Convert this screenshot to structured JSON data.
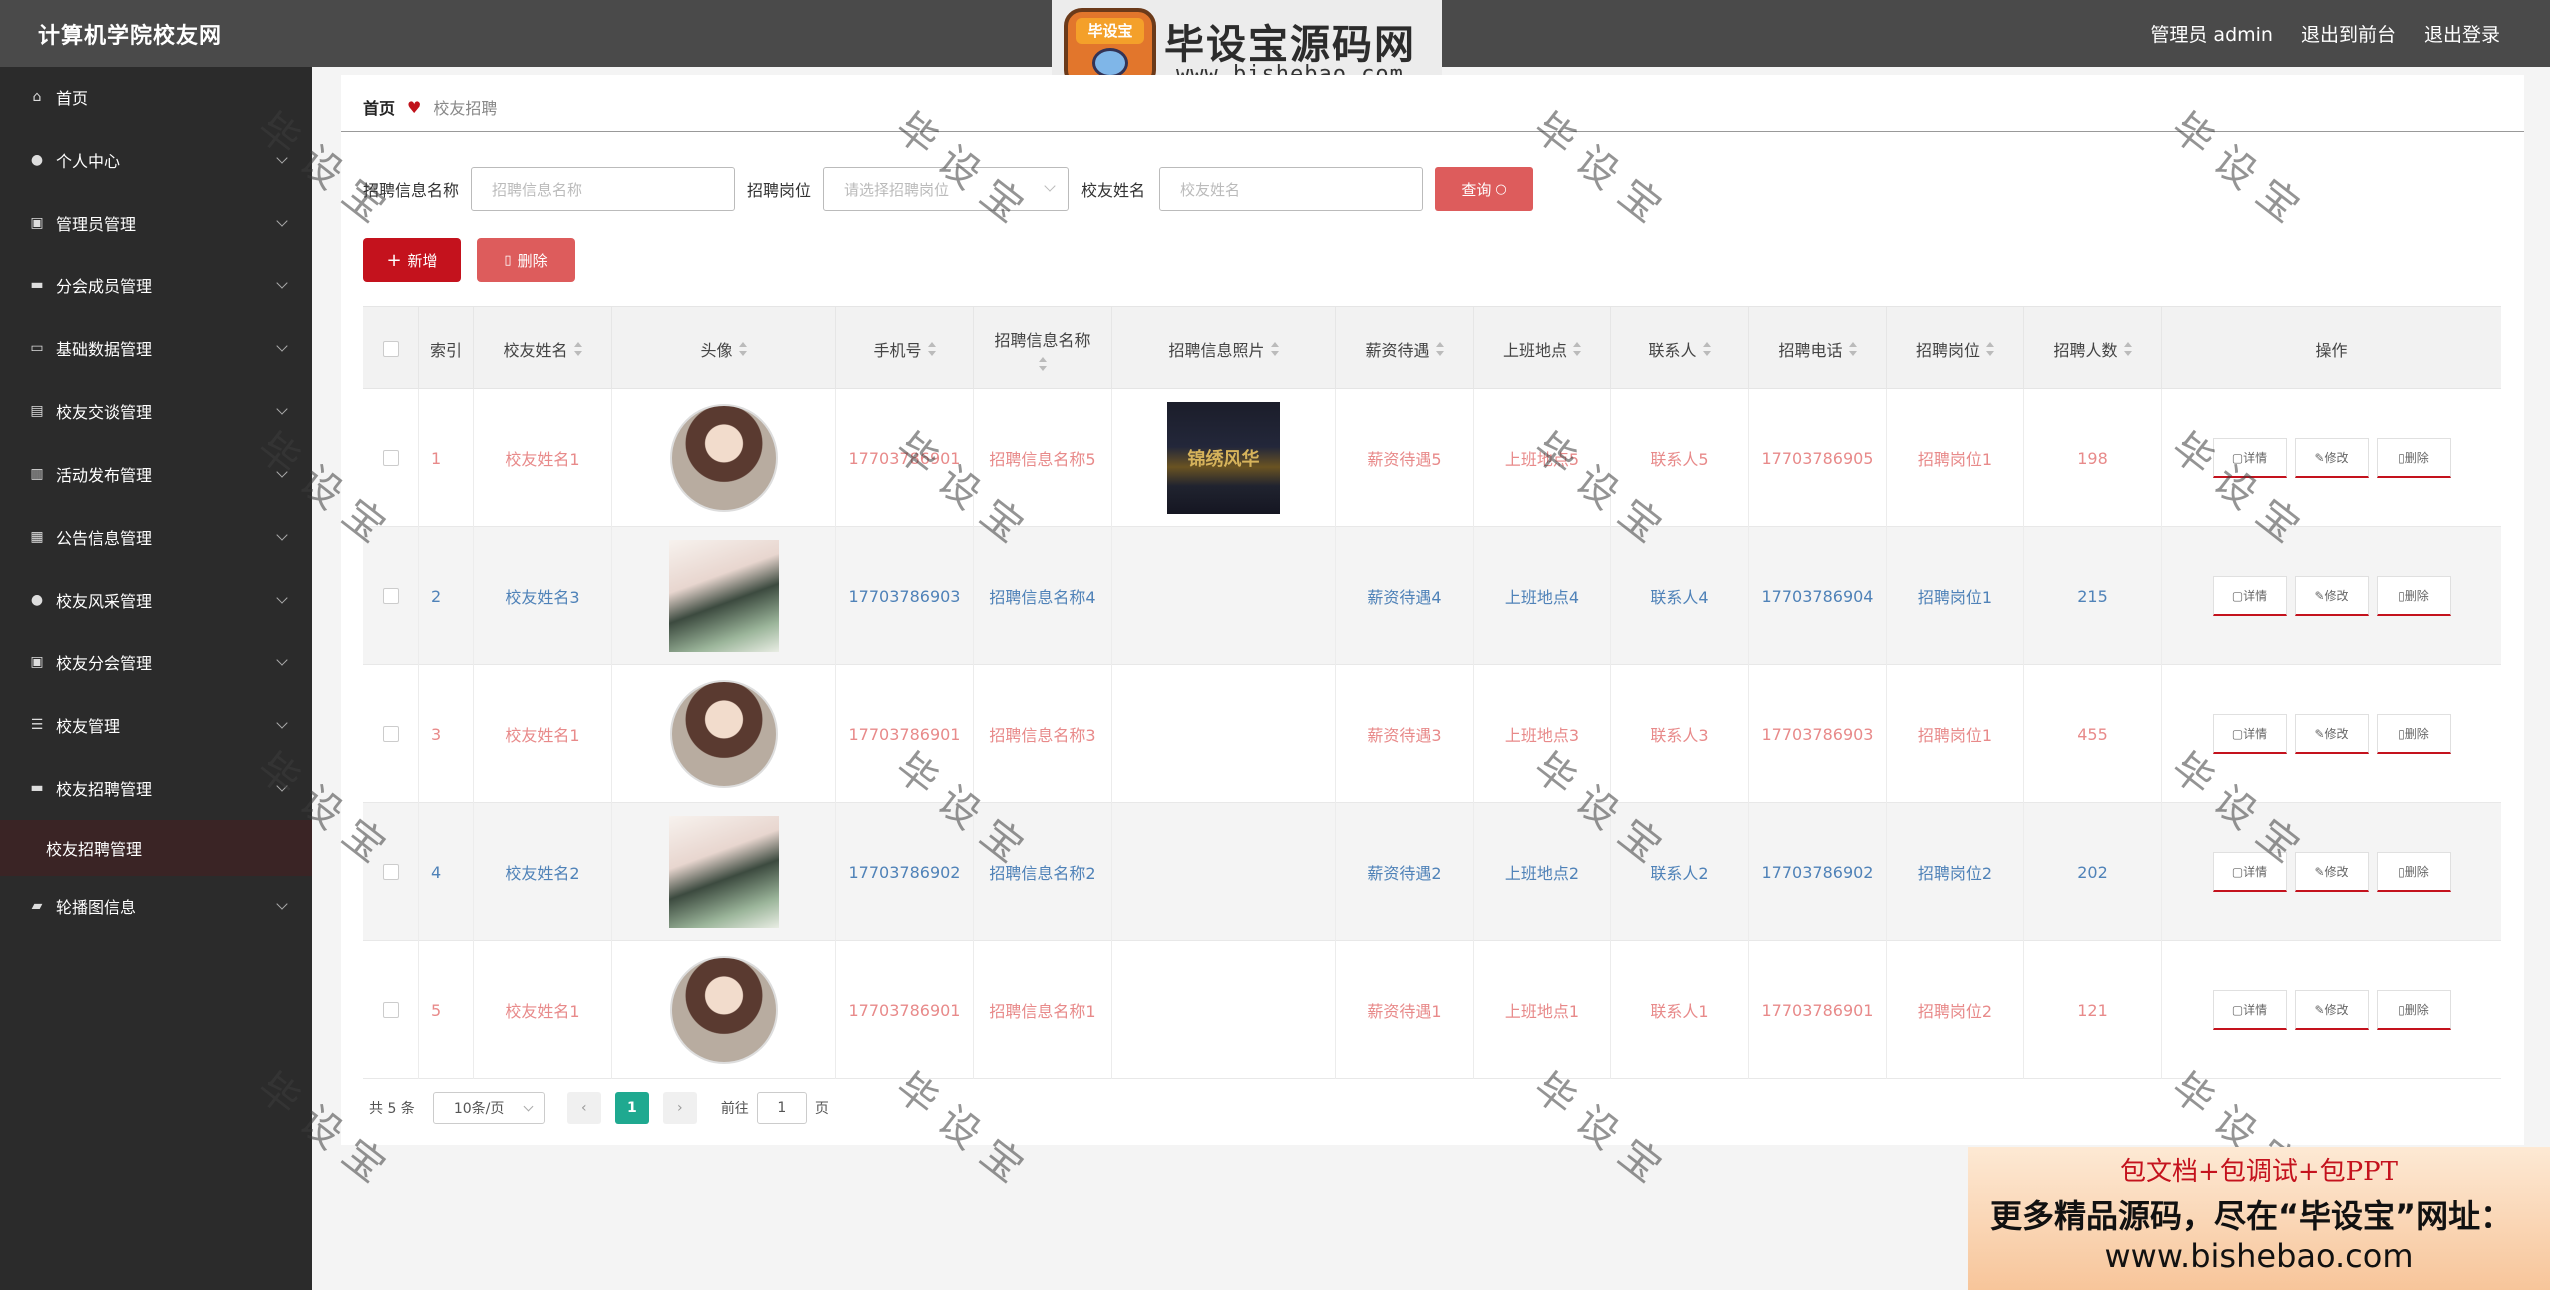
{
  "topbar": {
    "brand": "计算机学院校友网",
    "admin": "管理员 admin",
    "to_front": "退出到前台",
    "logout": "退出登录"
  },
  "logo": {
    "badge": "毕设宝",
    "title": "毕设宝源码网",
    "url": "www.bishebao.com"
  },
  "sidebar": {
    "items": [
      {
        "label": "首页",
        "icon": "home-icon"
      },
      {
        "label": "个人中心",
        "icon": "user-icon"
      },
      {
        "label": "管理员管理",
        "icon": "clipboard-icon"
      },
      {
        "label": "分会成员管理",
        "icon": "chat-icon"
      },
      {
        "label": "基础数据管理",
        "icon": "data-icon"
      },
      {
        "label": "校友交谈管理",
        "icon": "briefcase-icon"
      },
      {
        "label": "活动发布管理",
        "icon": "chart-icon"
      },
      {
        "label": "公告信息管理",
        "icon": "grid-icon"
      },
      {
        "label": "校友风采管理",
        "icon": "mic-icon"
      },
      {
        "label": "校友分会管理",
        "icon": "clipboard-icon"
      },
      {
        "label": "校友管理",
        "icon": "list-icon"
      },
      {
        "label": "校友招聘管理",
        "icon": "laptop-icon"
      },
      {
        "label": "轮播图信息",
        "icon": "image-icon"
      }
    ],
    "sub_active": "校友招聘管理"
  },
  "breadcrumb": {
    "home": "首页",
    "current": "校友招聘"
  },
  "search": {
    "label1": "招聘信息名称",
    "placeholder1": "招聘信息名称",
    "label2": "招聘岗位",
    "placeholder2": "请选择招聘岗位",
    "label3": "校友姓名",
    "placeholder3": "校友姓名",
    "query_label": "查询"
  },
  "actions": {
    "add_label": "新增",
    "delete_label": "删除"
  },
  "table": {
    "headers": {
      "index": "索引",
      "name": "校友姓名",
      "avatar": "头像",
      "phone": "手机号",
      "title": "招聘信息名称",
      "photo": "招聘信息照片",
      "salary": "薪资待遇",
      "place": "上班地点",
      "contact": "联系人",
      "tel": "招聘电话",
      "post": "招聘岗位",
      "count": "招聘人数",
      "ops": "操作"
    },
    "rows": [
      {
        "index": "1",
        "name": "校友姓名1",
        "phone": "17703786901",
        "title": "招聘信息名称5",
        "photo": "poster",
        "salary": "薪资待遇5",
        "place": "上班地点5",
        "contact": "联系人5",
        "tel": "17703786905",
        "post": "招聘岗位1",
        "count": "198",
        "avatar": "round"
      },
      {
        "index": "2",
        "name": "校友姓名3",
        "phone": "17703786903",
        "title": "招聘信息名称4",
        "photo": "",
        "salary": "薪资待遇4",
        "place": "上班地点4",
        "contact": "联系人4",
        "tel": "17703786904",
        "post": "招聘岗位1",
        "count": "215",
        "avatar": "square"
      },
      {
        "index": "3",
        "name": "校友姓名1",
        "phone": "17703786901",
        "title": "招聘信息名称3",
        "photo": "",
        "salary": "薪资待遇3",
        "place": "上班地点3",
        "contact": "联系人3",
        "tel": "17703786903",
        "post": "招聘岗位1",
        "count": "455",
        "avatar": "round"
      },
      {
        "index": "4",
        "name": "校友姓名2",
        "phone": "17703786902",
        "title": "招聘信息名称2",
        "photo": "",
        "salary": "薪资待遇2",
        "place": "上班地点2",
        "contact": "联系人2",
        "tel": "17703786902",
        "post": "招聘岗位2",
        "count": "202",
        "avatar": "square"
      },
      {
        "index": "5",
        "name": "校友姓名1",
        "phone": "17703786901",
        "title": "招聘信息名称1",
        "photo": "",
        "salary": "薪资待遇1",
        "place": "上班地点1",
        "contact": "联系人1",
        "tel": "17703786901",
        "post": "招聘岗位2",
        "count": "121",
        "avatar": "round"
      }
    ],
    "op_labels": {
      "detail": "详情",
      "edit": "修改",
      "delete": "删除"
    },
    "poster_text": "锦绣风华"
  },
  "pager": {
    "total": "共 5 条",
    "page_size": "10条/页",
    "current": "1",
    "goto_prefix": "前往",
    "goto_value": "1",
    "goto_suffix": "页"
  },
  "watermark": "毕设宝",
  "promo": {
    "line1": "包文档+包调试+包PPT",
    "line2": "更多精品源码，尽在“毕设宝”网址：",
    "line3": "www.bishebao.com"
  }
}
